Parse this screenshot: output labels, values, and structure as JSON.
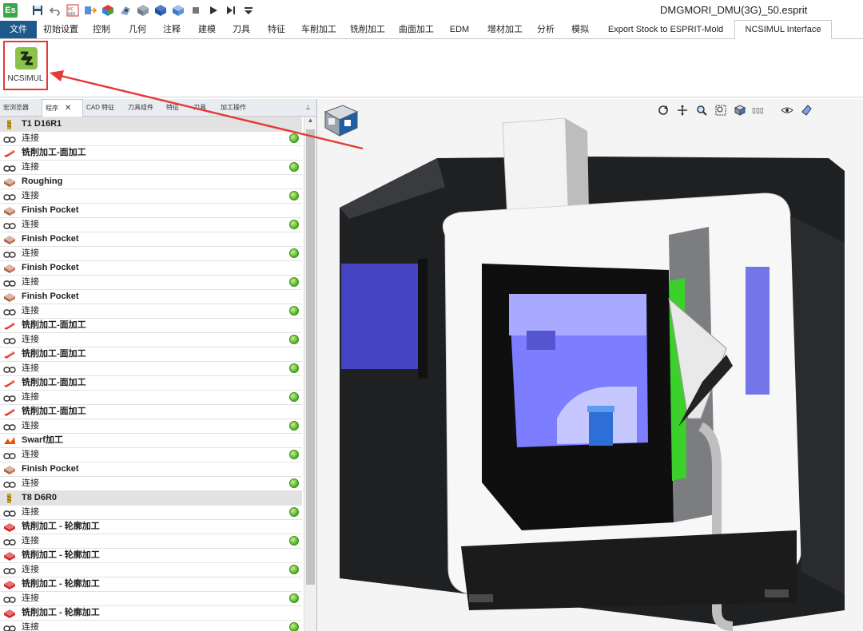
{
  "app": {
    "logo": "Es",
    "document_title": "DMGMORI_DMU(3G)_50.esprit",
    "quick_access_icons": [
      "save-icon",
      "undo-icon",
      "nc-code-icon",
      "transfer-icon",
      "solid-color-icon",
      "simulate-part-icon",
      "stock-icon",
      "stock-blue-icon",
      "cube-icon",
      "stop-icon",
      "play-icon",
      "step-icon",
      "customize-dropdown-icon"
    ]
  },
  "ribbon": {
    "tabs": [
      "文件",
      "初始设置",
      "控制",
      "几何",
      "注释",
      "建模",
      "刀具",
      "特征",
      "车削加工",
      "铣削加工",
      "曲面加工",
      "EDM",
      "增材加工",
      "分析",
      "模拟",
      "Export Stock to ESPRIT-Mold",
      "NCSIMUL Interface"
    ],
    "active_tab": "NCSIMUL Interface",
    "ncsimul_label": "NCSIMUL"
  },
  "panel": {
    "tabs": [
      "宏浏览器",
      "程序",
      "CAD 特征",
      "刀具组件",
      "特征",
      "刀具",
      "加工操作"
    ],
    "active_tab": "程序",
    "close_glyph": "✕",
    "pin_glyph": "⊥",
    "rows": [
      {
        "type": "group",
        "label": "T1  D16R1",
        "icon": "tool-icon"
      },
      {
        "type": "link",
        "label": "连接",
        "icon": "link-icon",
        "status": true
      },
      {
        "type": "op",
        "label": "铣削加工-面加工",
        "icon": "face-mill-icon"
      },
      {
        "type": "link",
        "label": "连接",
        "icon": "link-icon",
        "status": true
      },
      {
        "type": "op",
        "label": "Roughing",
        "icon": "pocket-icon"
      },
      {
        "type": "link",
        "label": "连接",
        "icon": "link-icon",
        "status": true
      },
      {
        "type": "op",
        "label": "Finish Pocket",
        "icon": "pocket-icon"
      },
      {
        "type": "link",
        "label": "连接",
        "icon": "link-icon",
        "status": true
      },
      {
        "type": "op",
        "label": "Finish Pocket",
        "icon": "pocket-icon"
      },
      {
        "type": "link",
        "label": "连接",
        "icon": "link-icon",
        "status": true
      },
      {
        "type": "op",
        "label": "Finish Pocket",
        "icon": "pocket-icon"
      },
      {
        "type": "link",
        "label": "连接",
        "icon": "link-icon",
        "status": true
      },
      {
        "type": "op",
        "label": "Finish Pocket",
        "icon": "pocket-icon"
      },
      {
        "type": "link",
        "label": "连接",
        "icon": "link-icon",
        "status": true
      },
      {
        "type": "op",
        "label": "铣削加工-面加工",
        "icon": "face-mill-icon"
      },
      {
        "type": "link",
        "label": "连接",
        "icon": "link-icon",
        "status": true
      },
      {
        "type": "op",
        "label": "铣削加工-面加工",
        "icon": "face-mill-icon"
      },
      {
        "type": "link",
        "label": "连接",
        "icon": "link-icon",
        "status": true
      },
      {
        "type": "op",
        "label": "铣削加工-面加工",
        "icon": "face-mill-icon"
      },
      {
        "type": "link",
        "label": "连接",
        "icon": "link-icon",
        "status": true
      },
      {
        "type": "op",
        "label": "铣削加工-面加工",
        "icon": "face-mill-icon"
      },
      {
        "type": "link",
        "label": "连接",
        "icon": "link-icon",
        "status": true
      },
      {
        "type": "op",
        "label": "Swarf加工",
        "icon": "swarf-icon"
      },
      {
        "type": "link",
        "label": "连接",
        "icon": "link-icon",
        "status": true
      },
      {
        "type": "op",
        "label": "Finish Pocket",
        "icon": "pocket-icon"
      },
      {
        "type": "link",
        "label": "连接",
        "icon": "link-icon",
        "status": true
      },
      {
        "type": "group",
        "label": "T8  D6R0",
        "icon": "tool-icon"
      },
      {
        "type": "link",
        "label": "连接",
        "icon": "link-icon",
        "status": true
      },
      {
        "type": "op",
        "label": "铣削加工 - 轮廓加工",
        "icon": "contour-icon"
      },
      {
        "type": "link",
        "label": "连接",
        "icon": "link-icon",
        "status": true
      },
      {
        "type": "op",
        "label": "铣削加工 - 轮廓加工",
        "icon": "contour-icon"
      },
      {
        "type": "link",
        "label": "连接",
        "icon": "link-icon",
        "status": true
      },
      {
        "type": "op",
        "label": "铣削加工 - 轮廓加工",
        "icon": "contour-icon"
      },
      {
        "type": "link",
        "label": "连接",
        "icon": "link-icon",
        "status": true
      },
      {
        "type": "op",
        "label": "铣削加工 - 轮廓加工",
        "icon": "contour-icon"
      },
      {
        "type": "link",
        "label": "连接",
        "icon": "link-icon",
        "status": true
      }
    ]
  },
  "viewport": {
    "toolbar_icons": [
      "rotate-icon",
      "pan-icon",
      "zoom-icon",
      "zoom-window-icon",
      "view-cube-icon",
      "display-mode-icon",
      "visibility-eye-icon",
      "shading-icon"
    ],
    "toolbar_text": "▯▯▯",
    "machine": "DMG MORI 5-axis machining center",
    "window_tint": "#7d7dff",
    "status_light": "#3bd12a"
  },
  "colors": {
    "file_tab": "#1d5a8b",
    "annotation": "#e53935",
    "status_ok": "#4caf25"
  }
}
